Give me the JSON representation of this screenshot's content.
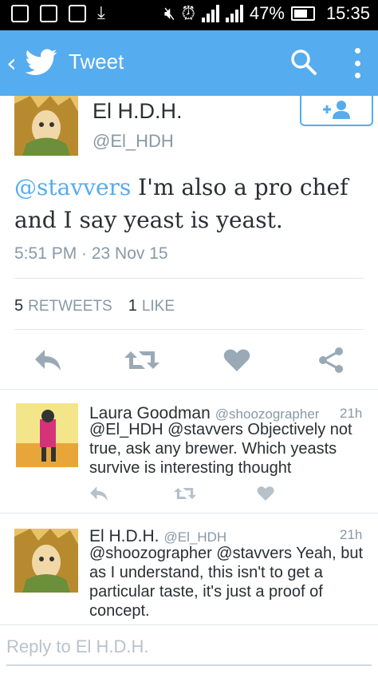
{
  "status_bar": {
    "battery": "47%",
    "time": "15:35"
  },
  "app_bar": {
    "title": "Tweet"
  },
  "tweet": {
    "author_name": "El H.D.H.",
    "author_handle": "@El_HDH",
    "mention": "@stavvers",
    "text": " I'm also a pro chef and I say yeast is yeast.",
    "timestamp": "5:51 PM · 23 Nov 15",
    "retweets_count": "5",
    "retweets_label": "RETWEETS",
    "likes_count": "1",
    "likes_label": "LIKE"
  },
  "replies": [
    {
      "name": "Laura Goodman",
      "handle": "@shoozographer",
      "time": "21h",
      "text": "@El_HDH @stavvers Objectively not true, ask any brewer.  Which yeasts survive is interesting thought"
    },
    {
      "name": "El H.D.H.",
      "handle": "@El_HDH",
      "time": "21h",
      "text": "@shoozographer @stavvers Yeah, but as I understand, this isn't to get a particular taste, it's just a proof of concept."
    }
  ],
  "compose": {
    "placeholder": "Reply to El H.D.H."
  },
  "colors": {
    "brand": "#55acee",
    "text": "#292f33",
    "muted": "#8899a6"
  }
}
